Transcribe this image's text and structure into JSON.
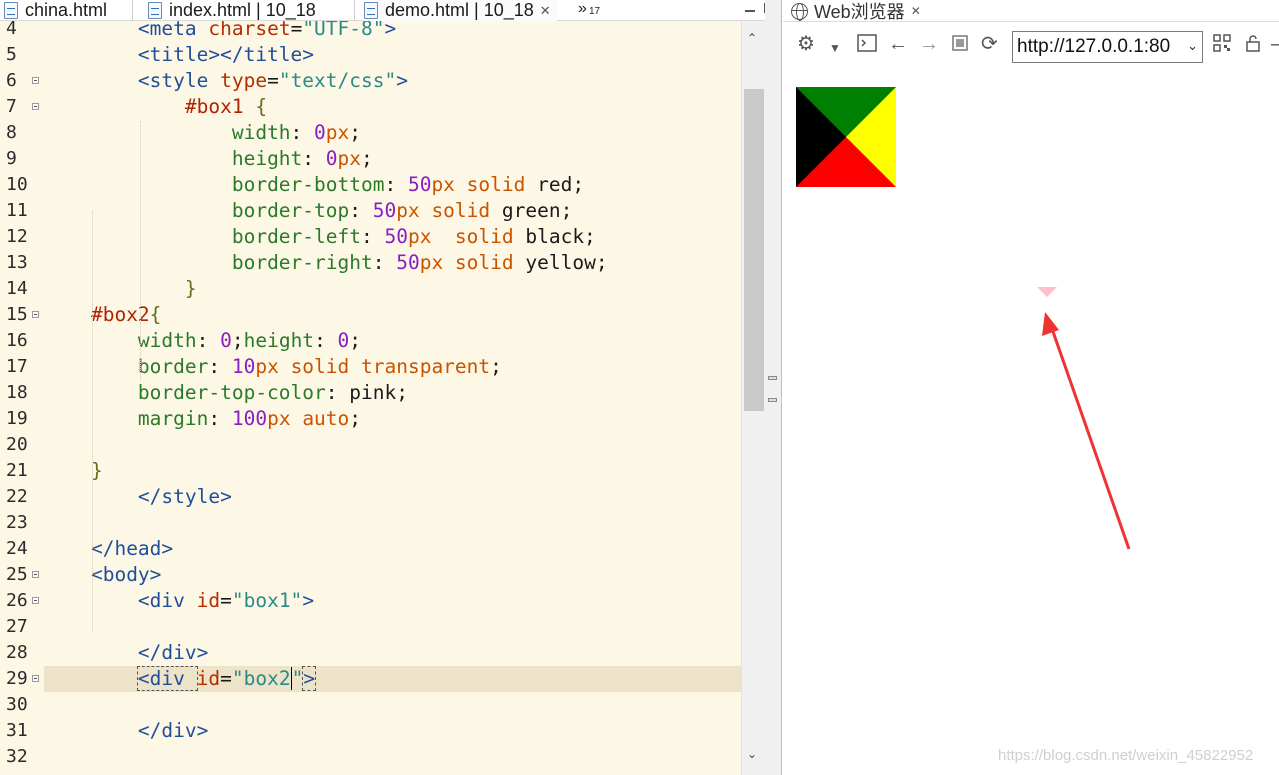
{
  "editor": {
    "tabs": [
      {
        "label": "china.html"
      },
      {
        "label": "index.html | 10_18"
      },
      {
        "label": "demo.html | 10_18",
        "close": "✕"
      }
    ],
    "overflow": {
      "chevron": "»",
      "count": "17"
    },
    "lines": [
      {
        "n": "4",
        "tokens": [
          [
            "",
            "        "
          ],
          [
            "tag",
            "<meta "
          ],
          [
            "attr",
            "charset"
          ],
          [
            "txt",
            "="
          ],
          [
            "str",
            "\"UTF-8\""
          ],
          [
            "tag",
            ">"
          ]
        ]
      },
      {
        "n": "5",
        "tokens": [
          [
            "",
            "        "
          ],
          [
            "tag",
            "<title></title>"
          ]
        ]
      },
      {
        "n": "6",
        "fold": true,
        "tokens": [
          [
            "",
            "        "
          ],
          [
            "tag",
            "<style "
          ],
          [
            "attr",
            "type"
          ],
          [
            "txt",
            "="
          ],
          [
            "str",
            "\"text/css\""
          ],
          [
            "tag",
            ">"
          ]
        ]
      },
      {
        "n": "7",
        "fold": true,
        "tokens": [
          [
            "",
            "            "
          ],
          [
            "sel",
            "#box1 "
          ],
          [
            "brace",
            "{"
          ]
        ]
      },
      {
        "n": "8",
        "tokens": [
          [
            "",
            "                "
          ],
          [
            "prop",
            "width"
          ],
          [
            "txt",
            ": "
          ],
          [
            "num",
            "0"
          ],
          [
            "kw",
            "px"
          ],
          [
            "txt",
            ";"
          ]
        ]
      },
      {
        "n": "9",
        "tokens": [
          [
            "",
            "                "
          ],
          [
            "prop",
            "height"
          ],
          [
            "txt",
            ": "
          ],
          [
            "num",
            "0"
          ],
          [
            "kw",
            "px"
          ],
          [
            "txt",
            ";"
          ]
        ]
      },
      {
        "n": "10",
        "tokens": [
          [
            "",
            "                "
          ],
          [
            "prop",
            "border-bottom"
          ],
          [
            "txt",
            ": "
          ],
          [
            "num",
            "50"
          ],
          [
            "kw",
            "px solid "
          ],
          [
            "txt",
            "red;"
          ]
        ]
      },
      {
        "n": "11",
        "tokens": [
          [
            "",
            "                "
          ],
          [
            "prop",
            "border-top"
          ],
          [
            "txt",
            ": "
          ],
          [
            "num",
            "50"
          ],
          [
            "kw",
            "px solid "
          ],
          [
            "txt",
            "green;"
          ]
        ]
      },
      {
        "n": "12",
        "tokens": [
          [
            "",
            "                "
          ],
          [
            "prop",
            "border-left"
          ],
          [
            "txt",
            ": "
          ],
          [
            "num",
            "50"
          ],
          [
            "kw",
            "px  solid "
          ],
          [
            "txt",
            "black;"
          ]
        ]
      },
      {
        "n": "13",
        "tokens": [
          [
            "",
            "                "
          ],
          [
            "prop",
            "border-right"
          ],
          [
            "txt",
            ": "
          ],
          [
            "num",
            "50"
          ],
          [
            "kw",
            "px solid "
          ],
          [
            "txt",
            "yellow;"
          ]
        ]
      },
      {
        "n": "14",
        "tokens": [
          [
            "",
            "            "
          ],
          [
            "brace",
            "}"
          ]
        ]
      },
      {
        "n": "15",
        "fold": true,
        "tokens": [
          [
            "",
            "    "
          ],
          [
            "sel",
            "#box2"
          ],
          [
            "brace",
            "{"
          ]
        ]
      },
      {
        "n": "16",
        "tokens": [
          [
            "",
            "        "
          ],
          [
            "prop",
            "width"
          ],
          [
            "txt",
            ": "
          ],
          [
            "num",
            "0"
          ],
          [
            "txt",
            ";"
          ],
          [
            "prop",
            "height"
          ],
          [
            "txt",
            ": "
          ],
          [
            "num",
            "0"
          ],
          [
            "txt",
            ";"
          ]
        ]
      },
      {
        "n": "17",
        "tokens": [
          [
            "",
            "        "
          ],
          [
            "prop",
            "border"
          ],
          [
            "txt",
            ": "
          ],
          [
            "num",
            "10"
          ],
          [
            "kw",
            "px solid transparent"
          ],
          [
            "txt",
            ";"
          ]
        ]
      },
      {
        "n": "18",
        "tokens": [
          [
            "",
            "        "
          ],
          [
            "prop",
            "border-top-color"
          ],
          [
            "txt",
            ": pink;"
          ]
        ]
      },
      {
        "n": "19",
        "tokens": [
          [
            "",
            "        "
          ],
          [
            "prop",
            "margin"
          ],
          [
            "txt",
            ": "
          ],
          [
            "num",
            "100"
          ],
          [
            "kw",
            "px auto"
          ],
          [
            "txt",
            ";"
          ]
        ]
      },
      {
        "n": "20",
        "tokens": []
      },
      {
        "n": "21",
        "tokens": [
          [
            "",
            "    "
          ],
          [
            "brace",
            "}"
          ]
        ]
      },
      {
        "n": "22",
        "tokens": [
          [
            "",
            "        "
          ],
          [
            "tag",
            "</style>"
          ]
        ]
      },
      {
        "n": "23",
        "tokens": []
      },
      {
        "n": "24",
        "tokens": [
          [
            "",
            "    "
          ],
          [
            "tag",
            "</head>"
          ]
        ]
      },
      {
        "n": "25",
        "fold": true,
        "tokens": [
          [
            "",
            "    "
          ],
          [
            "tag",
            "<body>"
          ]
        ]
      },
      {
        "n": "26",
        "fold": true,
        "tokens": [
          [
            "",
            "        "
          ],
          [
            "tag",
            "<div "
          ],
          [
            "attr",
            "id"
          ],
          [
            "txt",
            "="
          ],
          [
            "str",
            "\"box1\""
          ],
          [
            "tag",
            ">"
          ]
        ]
      },
      {
        "n": "27",
        "tokens": []
      },
      {
        "n": "28",
        "tokens": [
          [
            "",
            "        "
          ],
          [
            "tag",
            "</div>"
          ]
        ]
      },
      {
        "n": "29",
        "fold": true,
        "current": true,
        "tokens": [
          [
            "",
            "        "
          ],
          [
            "tag",
            "<div "
          ],
          [
            "attr",
            "id"
          ],
          [
            "txt",
            "="
          ],
          [
            "str",
            "\"box2"
          ],
          [
            "caret",
            ""
          ],
          [
            "str",
            "\""
          ],
          [
            "tag",
            ">"
          ]
        ]
      },
      {
        "n": "30",
        "tokens": []
      },
      {
        "n": "31",
        "tokens": [
          [
            "",
            "        "
          ],
          [
            "tag",
            "</div>"
          ]
        ]
      },
      {
        "n": "32",
        "tokens": []
      }
    ]
  },
  "browser": {
    "tab_title": "Web浏览器",
    "tab_close": "✕",
    "url": "http://127.0.0.1:80",
    "toolbar_icons": [
      "settings-icon",
      "dropdown-icon",
      "console-icon",
      "back-icon",
      "forward-icon",
      "stop-icon",
      "refresh-icon",
      "qr-code-icon",
      "lock-icon",
      "more-icon"
    ],
    "watermark": "https://blog.csdn.net/weixin_45822952"
  },
  "colors": {
    "box1_bottom": "#ff0000",
    "box1_top": "#008000",
    "box1_left": "#000000",
    "box1_right": "#ffff00",
    "box2_top": "#ffc0cb",
    "arrow": "#ee3333",
    "editor_bg": "#fdf8e6",
    "current_line": "#ece3c8"
  }
}
